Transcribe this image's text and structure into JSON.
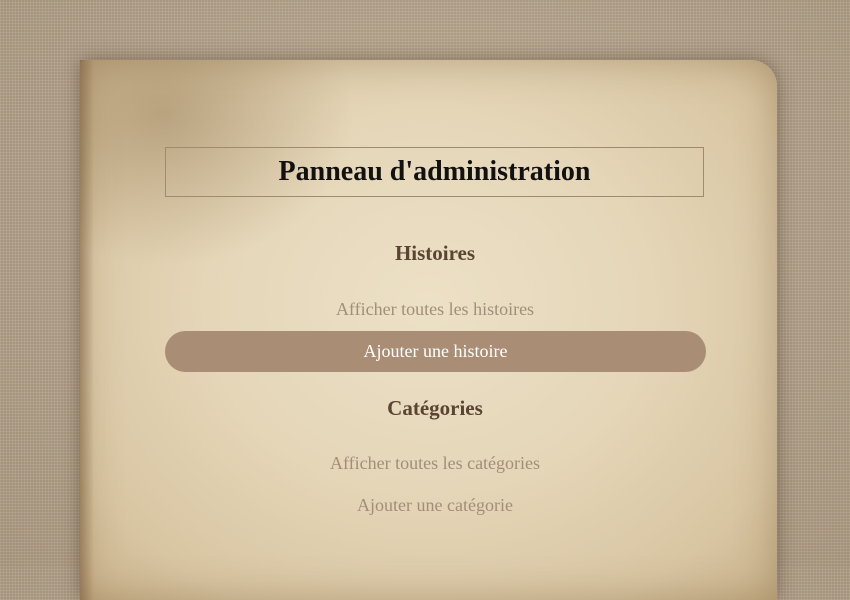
{
  "page": {
    "title": "Panneau d'administration"
  },
  "sections": [
    {
      "heading": "Histoires",
      "links": [
        {
          "label": "Afficher toutes les histoires",
          "active": false
        },
        {
          "label": "Ajouter une histoire",
          "active": true
        }
      ]
    },
    {
      "heading": "Catégories",
      "links": [
        {
          "label": "Afficher toutes les catégories",
          "active": false
        },
        {
          "label": "Ajouter une catégorie",
          "active": false
        }
      ]
    }
  ],
  "colors": {
    "background": "#b7a690",
    "paper": "#e5d6b8",
    "heading_text": "#5a4432",
    "link_text": "#a18e7a",
    "active_pill": "#a98d75",
    "active_text": "#ffffff"
  }
}
